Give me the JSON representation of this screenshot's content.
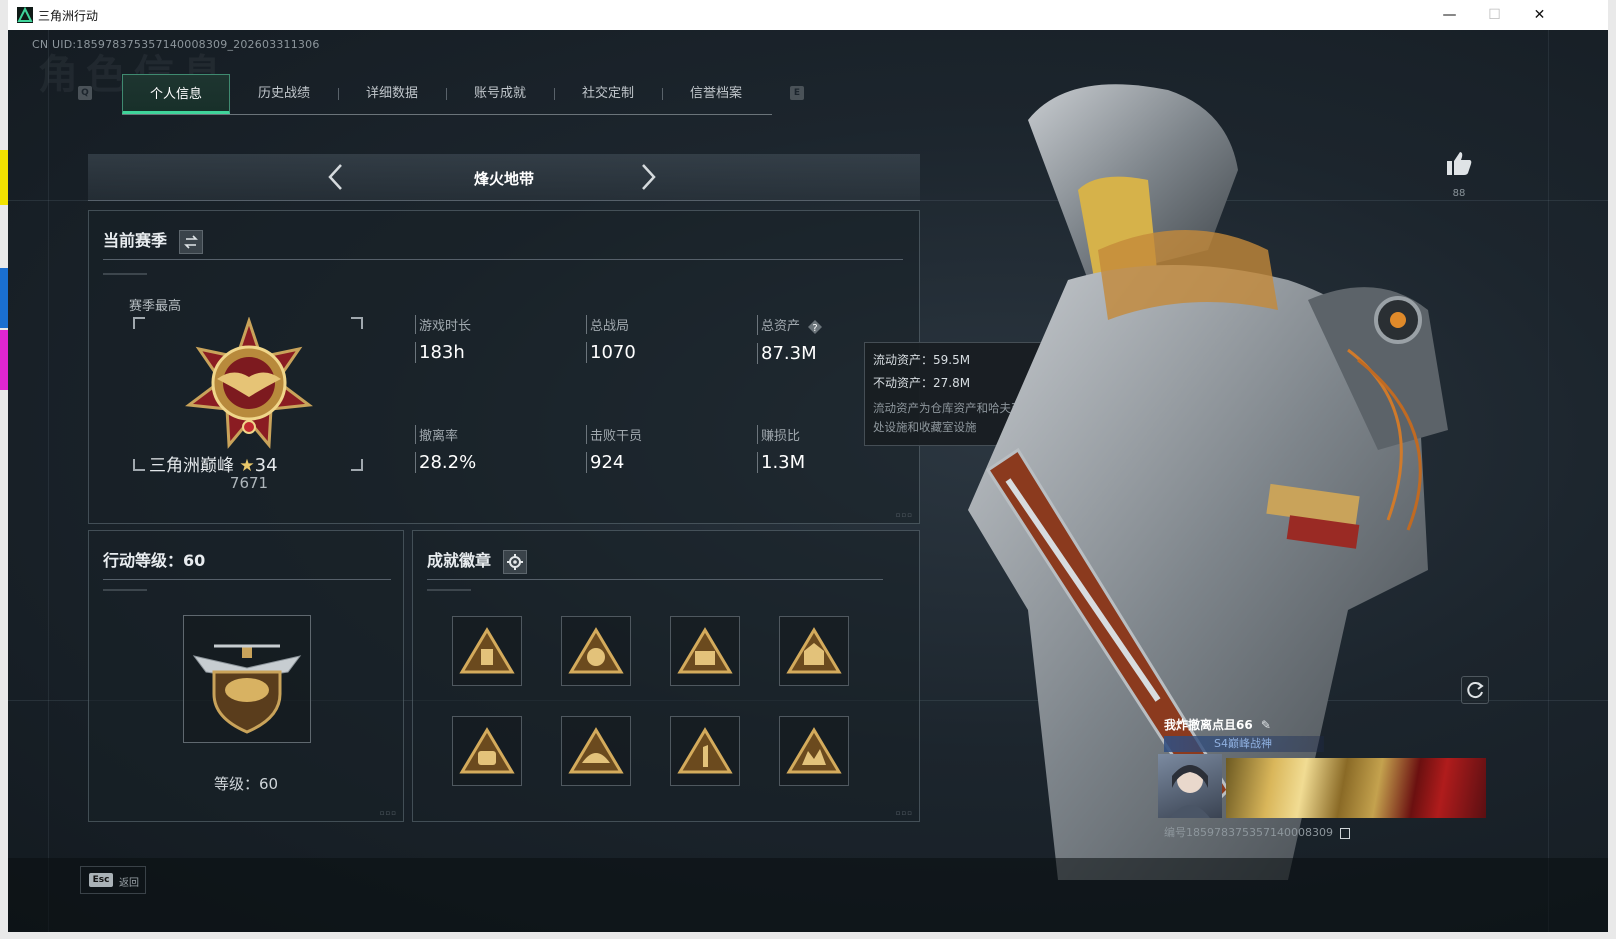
{
  "window": {
    "title": "三角洲行动",
    "minimize": "—",
    "maximize": "☐",
    "close": "✕"
  },
  "header": {
    "uid": "CN UID:185978375357140008309_202603311306",
    "watermark": "角色信息"
  },
  "tabs": {
    "left_key": "Q",
    "right_key": "E",
    "items": [
      {
        "label": "个人信息",
        "active": true
      },
      {
        "label": "历史战绩"
      },
      {
        "label": "详细数据"
      },
      {
        "label": "账号成就"
      },
      {
        "label": "社交定制"
      },
      {
        "label": "信誉档案"
      }
    ]
  },
  "mode_selector": {
    "title": "烽火地带"
  },
  "season": {
    "title": "当前赛季",
    "best_label": "赛季最高",
    "rank_name": "三角洲巅峰",
    "rank_star": "★",
    "rank_stars": "34",
    "rank_score": "7671",
    "stats": [
      {
        "label": "游戏时长",
        "value": "183h"
      },
      {
        "label": "总战局",
        "value": "1070"
      },
      {
        "label": "总资产",
        "value": "87.3M"
      },
      {
        "label": "撤离率",
        "value": "28.2%"
      },
      {
        "label": "击败干员",
        "value": "924"
      },
      {
        "label": "赚损比",
        "value": "1.3M"
      }
    ]
  },
  "tooltip": {
    "liquid": "流动资产：59.5M",
    "fixed": "不动资产：27.8M",
    "note": "流动资产为仓库资产和哈夫币，不动资产为特勤处设施和收藏室设施"
  },
  "level": {
    "title": "行动等级：60",
    "label": "等级：60"
  },
  "achievements": {
    "title": "成就徽章",
    "badges": [
      "badge-1",
      "badge-2",
      "badge-3",
      "badge-4",
      "badge-5",
      "badge-6",
      "badge-7",
      "badge-8"
    ]
  },
  "like": {
    "count": "88"
  },
  "player_card": {
    "name": "我炸撤离点且66",
    "title": "S4巅峰战神",
    "id_line": "编号1859783753571400083​09"
  },
  "bottom": {
    "esc_key": "Esc",
    "back_label": "返回"
  },
  "colors": {
    "accent": "#3fd49a",
    "panel_bg": "#1c252d",
    "gold": "#c9a35a"
  }
}
